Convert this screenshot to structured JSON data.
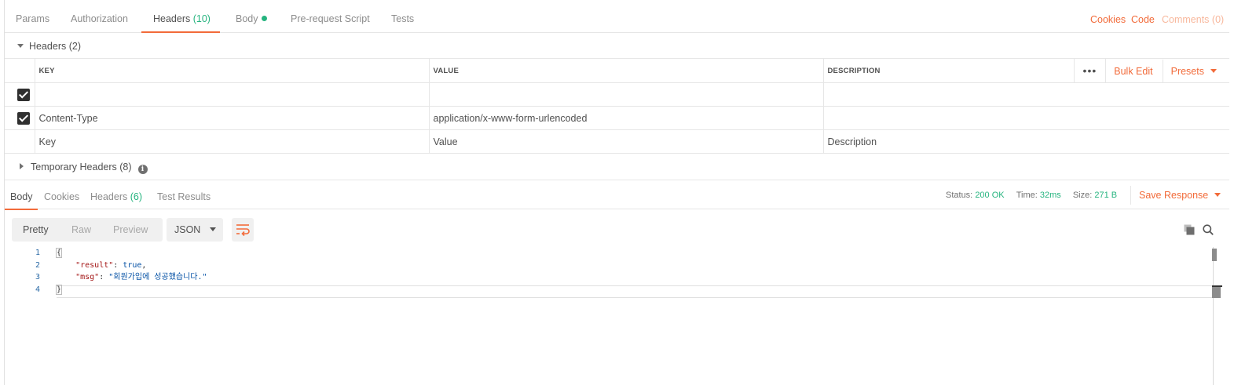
{
  "request_tabs": {
    "params": "Params",
    "authorization": "Authorization",
    "headers_label": "Headers",
    "headers_count": "(10)",
    "body": "Body",
    "pre_request": "Pre-request Script",
    "tests": "Tests",
    "cookies": "Cookies",
    "code": "Code",
    "comments": "Comments (0)"
  },
  "headers_section": {
    "title": "Headers (2)",
    "columns": {
      "key": "KEY",
      "value": "VALUE",
      "description": "DESCRIPTION"
    },
    "tools": {
      "more": "•••",
      "bulk_edit": "Bulk Edit",
      "presets": "Presets"
    },
    "rows": [
      {
        "checked": true,
        "key": "",
        "value": "",
        "description": ""
      },
      {
        "checked": true,
        "key": "Content-Type",
        "value": "application/x-www-form-urlencoded",
        "description": ""
      }
    ],
    "placeholders": {
      "key": "Key",
      "value": "Value",
      "description": "Description"
    }
  },
  "temporary_headers": "Temporary Headers (8)",
  "response_tabs": {
    "body": "Body",
    "cookies": "Cookies",
    "headers_label": "Headers",
    "headers_count": "(6)",
    "test_results": "Test Results"
  },
  "status": {
    "status_label": "Status:",
    "status_value": "200 OK",
    "time_label": "Time:",
    "time_value": "32ms",
    "size_label": "Size:",
    "size_value": "271 B",
    "save_response": "Save Response"
  },
  "view_modes": {
    "pretty": "Pretty",
    "raw": "Raw",
    "preview": "Preview",
    "format": "JSON"
  },
  "code_lines": [
    {
      "n": "1",
      "text": "{"
    },
    {
      "n": "2",
      "key": "\"result\"",
      "sep": ": ",
      "val": "true",
      "end": ","
    },
    {
      "n": "3",
      "key": "\"msg\"",
      "sep": ": ",
      "val": "\"회원가입에 성공했습니다.\"",
      "end": ""
    },
    {
      "n": "4",
      "text": "}"
    }
  ],
  "colors": {
    "accent": "#f26b3a",
    "success": "#26b47f"
  },
  "icons": [
    "info-icon",
    "copy-icon",
    "search-icon",
    "wrap-lines-icon",
    "checkbox-icon"
  ]
}
